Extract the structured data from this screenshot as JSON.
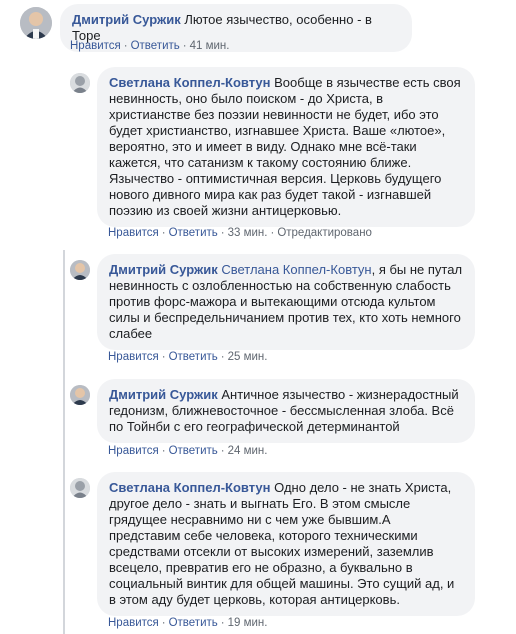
{
  "comments": [
    {
      "author": "Дмитрий Суржик",
      "mention": "",
      "text": "Лютое язычество, особенно - в Торе",
      "like": "Нравится",
      "reply": "Ответить",
      "time": "41 мин.",
      "edited": ""
    },
    {
      "author": "Светлана Коппел-Ковтун",
      "mention": "",
      "text": "Вообще в язычестве есть своя невинность, оно было поиском - до Христа, в христианстве без поэзии невинности не будет, ибо это будет христианство, изгнавшее Христа. Ваше «лютое», вероятно, это и имеет в виду. Однако мне всё-таки кажется, что сатанизм к такому состоянию ближе. Язычество - оптимистичная версия. Церковь будущего нового дивного мира как раз будет такой - изгнавшей поэзию из своей жизни антицерковью.",
      "like": "Нравится",
      "reply": "Ответить",
      "time": "33 мин.",
      "edited": "Отредактировано"
    },
    {
      "author": "Дмитрий Суржик",
      "mention": "Светлана Коппел-Ковтун",
      "text": ", я бы не путал невинность с озлобленностью на собственную слабость против форс-мажора и вытекающими отсюда культом силы и беспредельничанием против тех, кто хоть немного слабее",
      "like": "Нравится",
      "reply": "Ответить",
      "time": "25 мин.",
      "edited": ""
    },
    {
      "author": "Дмитрий Суржик",
      "mention": "",
      "text": "Античное язычество - жизнерадостный гедонизм, ближневосточное - бессмысленная злоба. Всё по Тойнби с его географической детерминантой",
      "like": "Нравится",
      "reply": "Ответить",
      "time": "24 мин.",
      "edited": ""
    },
    {
      "author": "Светлана Коппел-Ковтун",
      "mention": "",
      "text": "Одно дело - не знать Христа, другое дело - знать и выгнать Его. В этом смысле грядущее несравнимо ни с чем уже бывшим.А представим себе человека, которого техническими средствами отсекли от высоких измерений, заземлив всецело, превратив его не образно, а буквально в социальный винтик для общей машины. Это сущий ад, и в этом аду будет церковь, которая антицерковь.",
      "like": "Нравится",
      "reply": "Ответить",
      "time": "19 мин.",
      "edited": ""
    }
  ],
  "colors": {
    "author": "#385898",
    "bubble": "#f2f3f5",
    "meta": "#606770",
    "thread_line": "#d3d6db"
  }
}
